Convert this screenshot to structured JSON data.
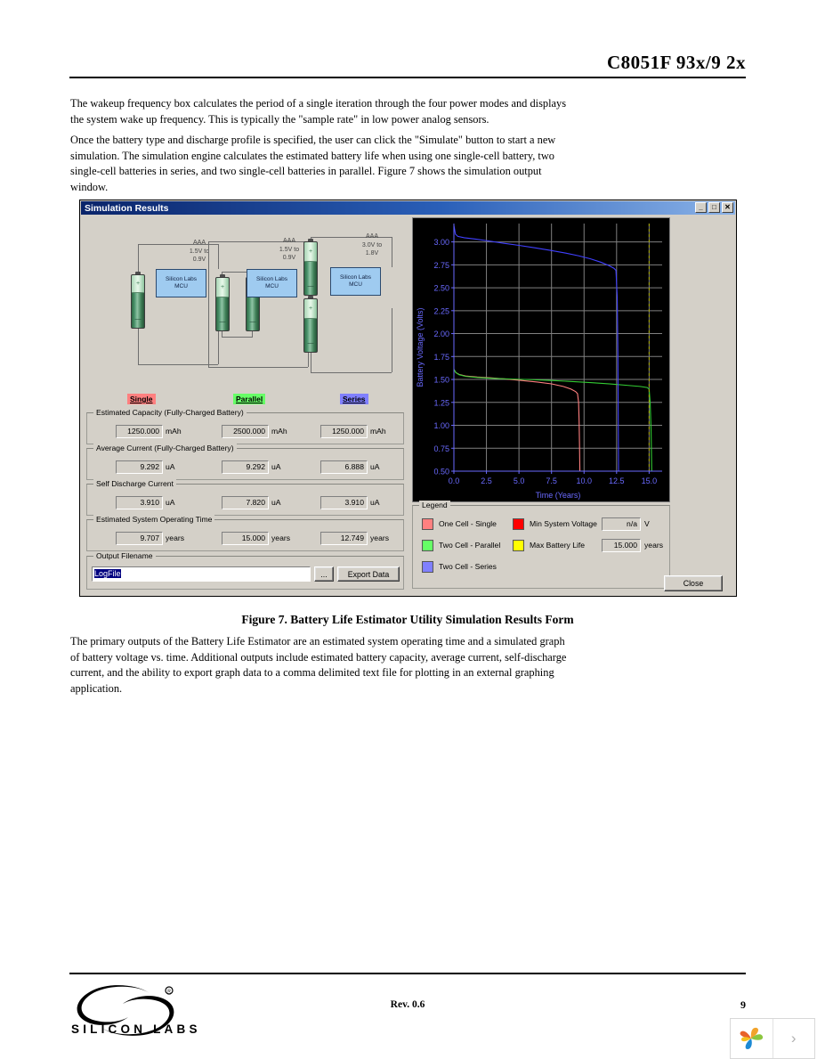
{
  "document": {
    "header_title": "C8051F 93x/9 2x",
    "paragraph_1": "The wakeup frequency box calculates the period of a single iteration through the four power modes and displays the system wake up frequency. This is typically the \"sample rate\" in low power analog sensors.",
    "paragraph_2": "Once the battery type and discharge profile is specified, the user can click the \"Simulate\" button to start a new simulation. The simulation engine calculates the estimated battery life when using one single-cell battery, two single-cell batteries in series, and two single-cell batteries in parallel. Figure 7 shows the simulation output window.",
    "figure_caption": "Figure 7. Battery Life Estimator Utility Simulation Results Form",
    "paragraph_3": "The primary outputs of the Battery Life Estimator are an estimated system operating time and a simulated graph of battery voltage vs. time. Additional outputs include estimated battery capacity, average current, self-discharge current, and the ability to export graph data to a comma delimited text file for plotting in an external graphing application.",
    "footer_revision": "Rev. 0.6",
    "footer_page_number": "9",
    "footer_brand": "SILICON LABS"
  },
  "window": {
    "title": "Simulation Results",
    "minimize_label": "_",
    "maximize_label": "□",
    "close_label": "✕"
  },
  "diagram": {
    "configs": [
      {
        "name": "single",
        "label": "AAA\n1.5V to\n0.9V",
        "mcu_line1": "Silicon Labs",
        "mcu_line2": "MCU"
      },
      {
        "name": "parallel",
        "label": "AAA\n1.5V to\n0.9V",
        "mcu_line1": "Silicon Labs",
        "mcu_line2": "MCU"
      },
      {
        "name": "series",
        "label": "AAA\n3.0V to\n1.8V",
        "mcu_line1": "Silicon Labs",
        "mcu_line2": "MCU"
      }
    ],
    "battery_plus": "+",
    "battery_minus": "—"
  },
  "mode_labels": [
    {
      "text": "Single",
      "highlight": "#ff8080"
    },
    {
      "text": "Parallel",
      "highlight": "#66ff66"
    },
    {
      "text": "Series",
      "highlight": "#8080ff"
    }
  ],
  "groups": [
    {
      "title": "Estimated Capacity (Fully-Charged Battery)",
      "values": [
        "1250.000",
        "2500.000",
        "1250.000"
      ],
      "units": [
        "mAh",
        "mAh",
        "mAh"
      ]
    },
    {
      "title": "Average Current (Fully-Charged Battery)",
      "values": [
        "9.292",
        "9.292",
        "6.888"
      ],
      "units": [
        "uA",
        "uA",
        "uA"
      ]
    },
    {
      "title": "Self Discharge Current",
      "values": [
        "3.910",
        "7.820",
        "3.910"
      ],
      "units": [
        "uA",
        "uA",
        "uA"
      ]
    },
    {
      "title": "Estimated System Operating Time",
      "values": [
        "9.707",
        "15.000",
        "12.749"
      ],
      "units": [
        "years",
        "years",
        "years"
      ]
    }
  ],
  "output_filename": {
    "title": "Output Filename",
    "value": "LogFile",
    "browse_label": "...",
    "export_label": "Export Data"
  },
  "legend": {
    "title": "Legend",
    "series": [
      {
        "label": "One Cell - Single",
        "color": "#ff8080"
      },
      {
        "label": "Two Cell - Parallel",
        "color": "#66ff66"
      },
      {
        "label": "Two Cell - Series",
        "color": "#8080ff"
      }
    ],
    "markers": [
      {
        "label": "Min System Voltage",
        "color": "#ff0000",
        "value": "n/a",
        "unit": "V"
      },
      {
        "label": "Max Battery Life",
        "color": "#ffff00",
        "value": "15.000",
        "unit": "years"
      }
    ]
  },
  "close_button": {
    "label": "Close"
  },
  "chart_data": {
    "type": "line",
    "title": "",
    "xlabel": "Time (Years)",
    "ylabel": "Battery Voltage (Volts)",
    "xlim": [
      0.0,
      16.0
    ],
    "ylim": [
      0.5,
      3.2
    ],
    "xticks": [
      "0.0",
      "2.5",
      "5.0",
      "7.5",
      "10.0",
      "12.5",
      "15.0"
    ],
    "xtick_values": [
      0.0,
      2.5,
      5.0,
      7.5,
      10.0,
      12.5,
      15.0
    ],
    "yticks": [
      "0.50",
      "0.75",
      "1.00",
      "1.25",
      "1.50",
      "1.75",
      "2.00",
      "2.25",
      "2.50",
      "2.75",
      "3.00"
    ],
    "ytick_values": [
      0.5,
      0.75,
      1.0,
      1.25,
      1.5,
      1.75,
      2.0,
      2.25,
      2.5,
      2.75,
      3.0
    ],
    "grid": true,
    "background": "#000000",
    "axis_color": "#6a6aff",
    "grid_color": "#808080",
    "legend_position": "below-external",
    "series": [
      {
        "name": "One Cell - Single",
        "color": "#ff8080",
        "x": [
          0.0,
          0.15,
          0.4,
          0.9,
          1.8,
          2.8,
          4.0,
          5.2,
          6.4,
          7.5,
          8.4,
          9.0,
          9.35,
          9.5,
          9.58,
          9.62,
          9.65,
          9.68
        ],
        "y": [
          1.61,
          1.575,
          1.555,
          1.538,
          1.527,
          1.518,
          1.505,
          1.489,
          1.472,
          1.452,
          1.424,
          1.395,
          1.368,
          1.345,
          1.25,
          1.05,
          0.8,
          0.5
        ]
      },
      {
        "name": "Two Cell - Parallel",
        "color": "#33cc33",
        "x": [
          0.0,
          0.15,
          0.4,
          0.9,
          1.8,
          3.0,
          4.5,
          6.0,
          7.5,
          9.0,
          10.5,
          12.0,
          13.3,
          14.3,
          14.85,
          15.0,
          15.08,
          15.15,
          15.2
        ],
        "y": [
          1.61,
          1.575,
          1.552,
          1.533,
          1.522,
          1.512,
          1.504,
          1.498,
          1.489,
          1.478,
          1.466,
          1.451,
          1.436,
          1.424,
          1.412,
          1.395,
          1.25,
          0.95,
          0.5
        ]
      },
      {
        "name": "Two Cell - Series",
        "color": "#4040ff",
        "x": [
          0.0,
          0.12,
          0.3,
          0.8,
          1.6,
          2.6,
          3.8,
          5.0,
          6.2,
          7.4,
          8.6,
          9.6,
          10.5,
          11.3,
          11.9,
          12.3,
          12.45,
          12.55,
          12.6,
          12.65
        ],
        "y": [
          3.18,
          3.085,
          3.06,
          3.045,
          3.032,
          3.012,
          2.986,
          2.962,
          2.936,
          2.908,
          2.878,
          2.848,
          2.815,
          2.778,
          2.742,
          2.712,
          2.69,
          2.4,
          1.8,
          0.5
        ]
      }
    ],
    "vertical_markers": [
      {
        "name": "Max Battery Life",
        "x": 15.0,
        "color": "#aaaa00",
        "style": "dashed"
      }
    ]
  }
}
